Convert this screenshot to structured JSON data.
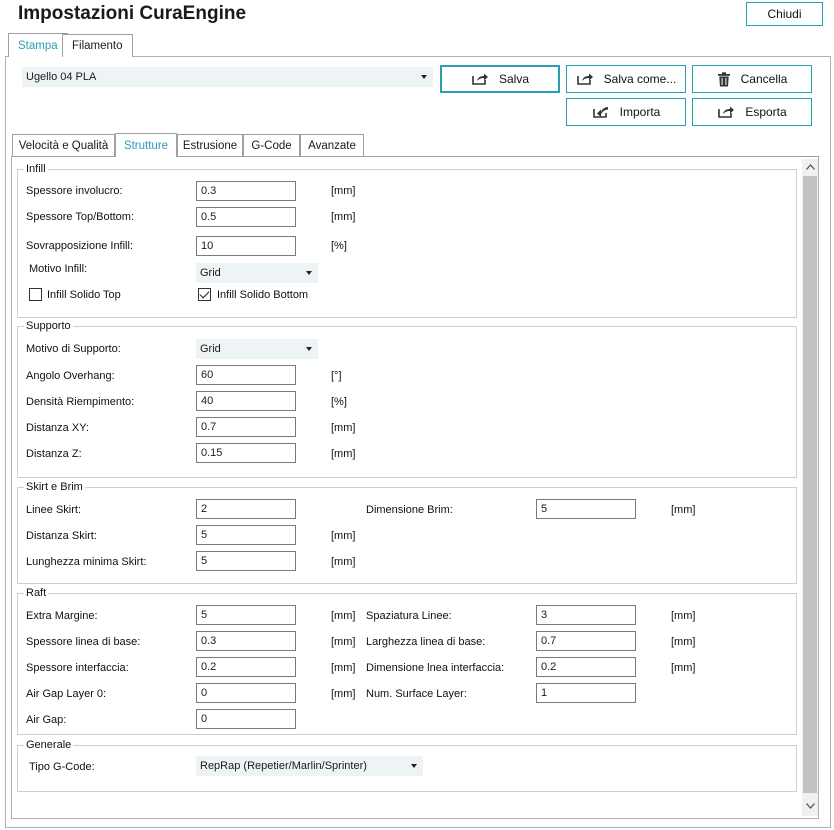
{
  "window": {
    "title": "Impostazioni CuraEngine",
    "close_label": "Chiudi"
  },
  "main_tabs": [
    {
      "label": "Stampa",
      "active": true
    },
    {
      "label": "Filamento",
      "active": false
    }
  ],
  "profile": {
    "selected": "Ugello 04 PLA"
  },
  "actions": {
    "save": "Salva",
    "save_as": "Salva come...",
    "delete": "Cancella",
    "import": "Importa",
    "export": "Esporta"
  },
  "sub_tabs": [
    {
      "label": "Velocità e Qualità",
      "active": false
    },
    {
      "label": "Strutture",
      "active": true
    },
    {
      "label": "Estrusione",
      "active": false
    },
    {
      "label": "G-Code",
      "active": false
    },
    {
      "label": "Avanzate",
      "active": false
    }
  ],
  "infill": {
    "title": "Infill",
    "shell_label": "Spessore involucro:",
    "shell_value": "0.3",
    "shell_unit": "[mm]",
    "topbottom_label": "Spessore Top/Bottom:",
    "topbottom_value": "0.5",
    "topbottom_unit": "[mm]",
    "overlap_label": "Sovrapposizione Infill:",
    "overlap_value": "10",
    "overlap_unit": "[%]",
    "pattern_label": "Motivo Infill:",
    "pattern_value": "Grid",
    "solid_top_label": "Infill Solido Top",
    "solid_top_checked": false,
    "solid_bottom_label": "Infill Solido Bottom",
    "solid_bottom_checked": true
  },
  "support": {
    "title": "Supporto",
    "pattern_label": "Motivo di Supporto:",
    "pattern_value": "Grid",
    "overhang_label": "Angolo Overhang:",
    "overhang_value": "60",
    "overhang_unit": "[°]",
    "density_label": "Densità Riempimento:",
    "density_value": "40",
    "density_unit": "[%]",
    "xy_label": "Distanza XY:",
    "xy_value": "0.7",
    "xy_unit": "[mm]",
    "z_label": "Distanza Z:",
    "z_value": "0.15",
    "z_unit": "[mm]"
  },
  "skirt": {
    "title": "Skirt e Brim",
    "lines_label": "Linee Skirt:",
    "lines_value": "2",
    "brim_label": "Dimensione Brim:",
    "brim_value": "5",
    "brim_unit": "[mm]",
    "distance_label": "Distanza Skirt:",
    "distance_value": "5",
    "distance_unit": "[mm]",
    "minlen_label": "Lunghezza minima Skirt:",
    "minlen_value": "5",
    "minlen_unit": "[mm]"
  },
  "raft": {
    "title": "Raft",
    "margin_label": "Extra Margine:",
    "margin_value": "5",
    "margin_unit": "[mm]",
    "spacing_label": "Spaziatura Linee:",
    "spacing_value": "3",
    "spacing_unit": "[mm]",
    "base_thick_label": "Spessore linea di base:",
    "base_thick_value": "0.3",
    "base_thick_unit": "[mm]",
    "base_width_label": "Larghezza linea di base:",
    "base_width_value": "0.7",
    "base_width_unit": "[mm]",
    "iface_thick_label": "Spessore interfaccia:",
    "iface_thick_value": "0.2",
    "iface_thick_unit": "[mm]",
    "iface_dim_label": "Dimensione lnea interfaccia:",
    "iface_dim_value": "0.2",
    "iface_dim_unit": "[mm]",
    "airgap0_label": "Air Gap Layer 0:",
    "airgap0_value": "0",
    "airgap0_unit": "[mm]",
    "surface_label": "Num. Surface Layer:",
    "surface_value": "1",
    "airgap_label": "Air Gap:",
    "airgap_value": "0"
  },
  "general": {
    "title": "Generale",
    "gcode_label": "Tipo G-Code:",
    "gcode_value": "RepRap (Repetier/Marlin/Sprinter)"
  },
  "colors": {
    "accent": "#2a9fb4",
    "combo_bg": "#eef4f5",
    "border": "#b0b0b0"
  }
}
